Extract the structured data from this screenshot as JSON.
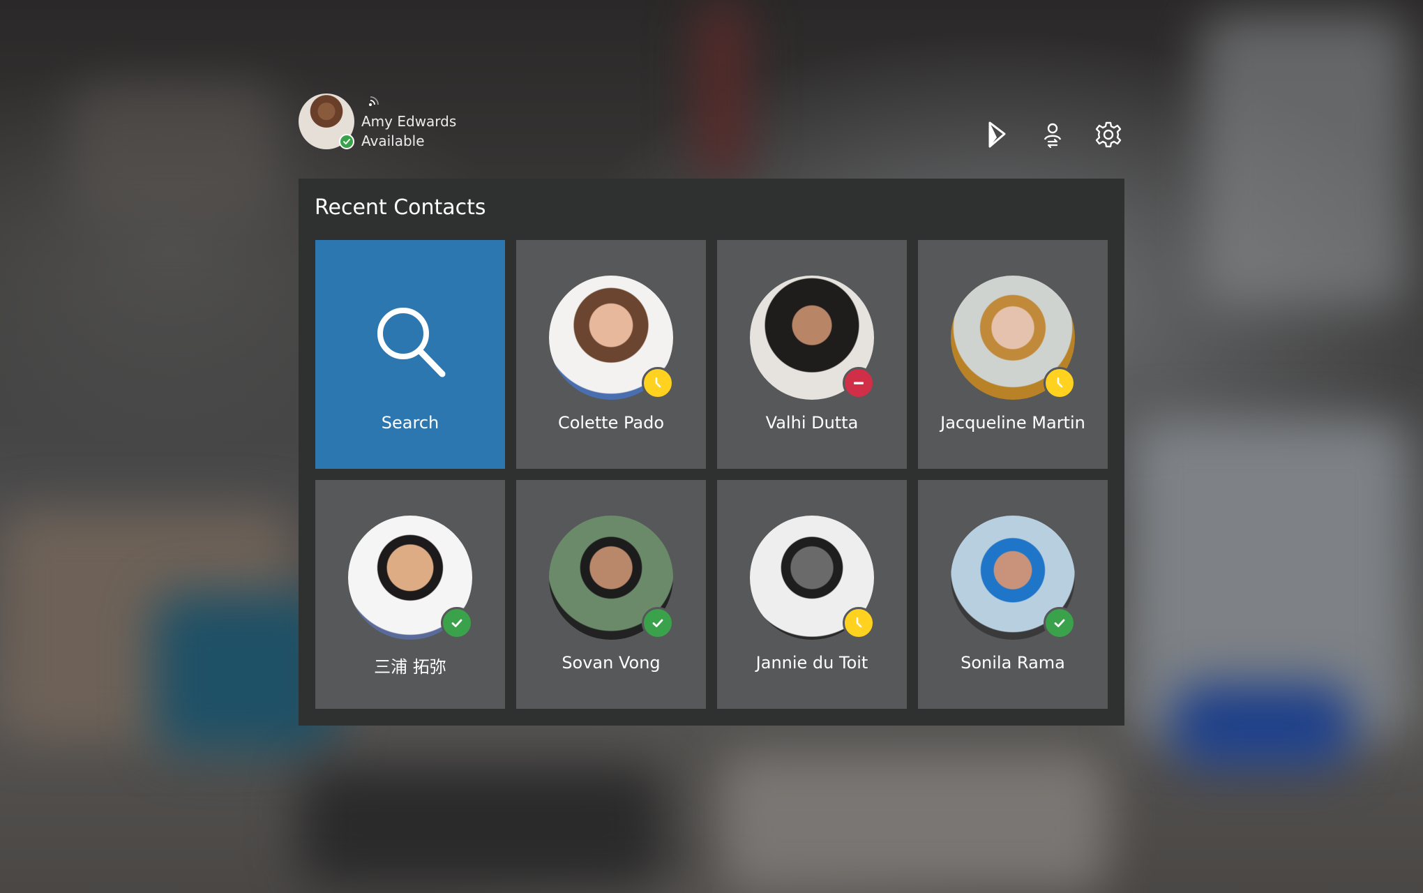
{
  "user": {
    "name": "Amy Edwards",
    "status": "Available",
    "status_type": "available"
  },
  "header_actions": [
    {
      "icon": "dynamics-logo-icon"
    },
    {
      "icon": "switch-account-icon"
    },
    {
      "icon": "gear-icon"
    }
  ],
  "panel": {
    "title": "Recent Contacts"
  },
  "search_tile": {
    "label": "Search",
    "icon": "search-icon"
  },
  "contacts": [
    {
      "name": "Colette Pado",
      "status": "away"
    },
    {
      "name": "Valhi Dutta",
      "status": "busy"
    },
    {
      "name": "Jacqueline Martin",
      "status": "away"
    },
    {
      "name": "三浦 拓弥",
      "status": "available"
    },
    {
      "name": "Sovan Vong",
      "status": "available"
    },
    {
      "name": "Jannie du Toit",
      "status": "away"
    },
    {
      "name": "Sonila Rama",
      "status": "available"
    }
  ],
  "colors": {
    "panel": "#2f3131",
    "tile": "#575859",
    "search_tile": "#2d77b0",
    "status_available": "#3aa24b",
    "status_away": "#ffd21f",
    "status_busy": "#d12e47"
  }
}
